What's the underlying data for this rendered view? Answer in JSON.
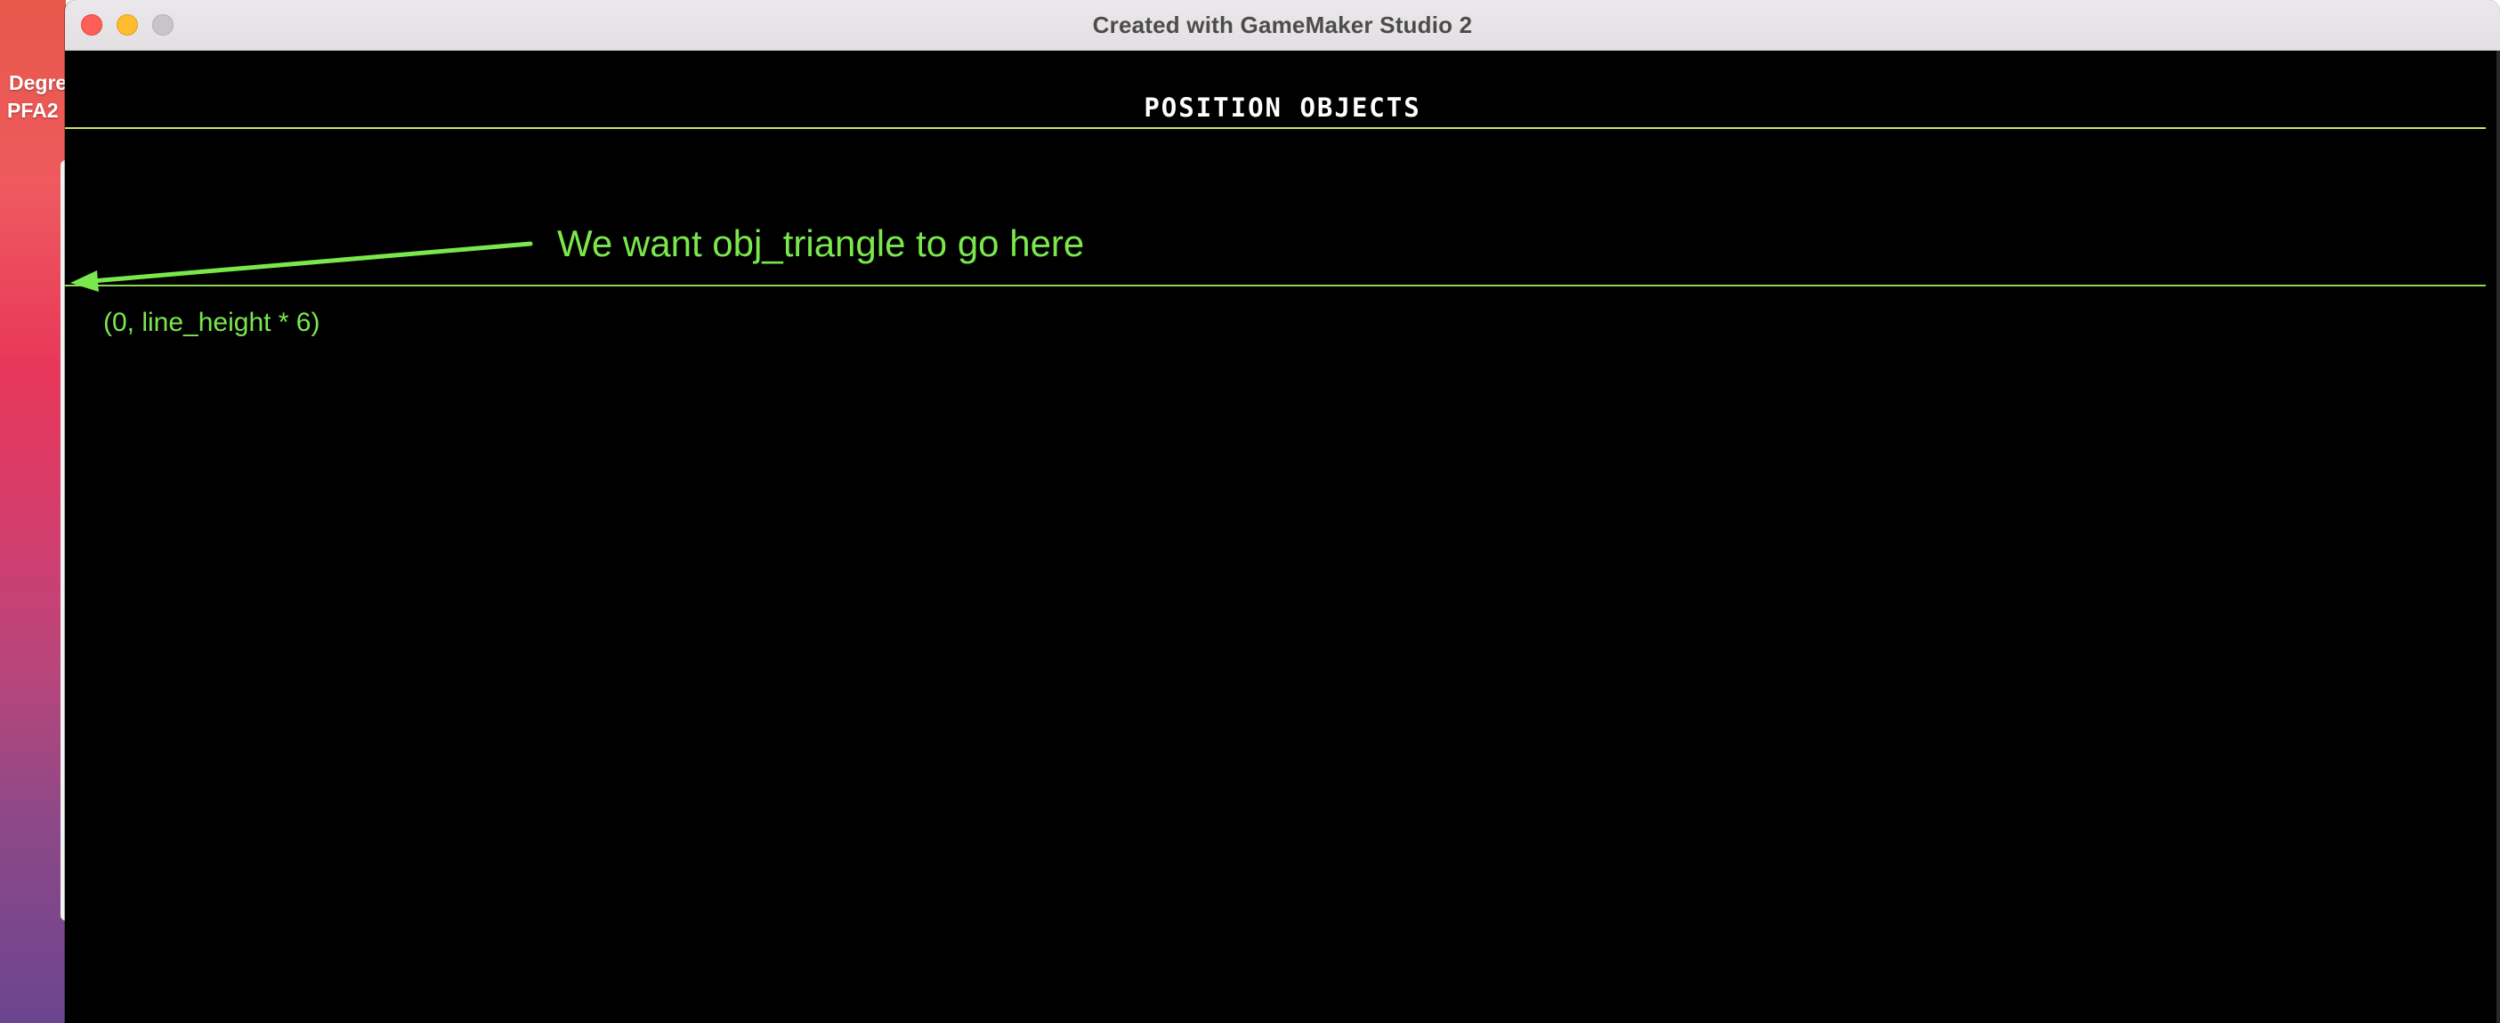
{
  "desktop": {
    "labels": [
      "Degre",
      "PFA2"
    ]
  },
  "window": {
    "title": "Created with GameMaker Studio 2",
    "traffic_lights": [
      "close",
      "minimize",
      "zoom"
    ]
  },
  "game": {
    "heading": "POSITION OBJECTS",
    "annotation": "We want obj_triangle to go here",
    "coordinate_label": "(0, line_height * 6)"
  },
  "colors": {
    "canvas_background": "#000000",
    "heading_rule": "#d8de5a",
    "annotation_green": "#7ae84d",
    "target_line": "#8ed64e"
  }
}
